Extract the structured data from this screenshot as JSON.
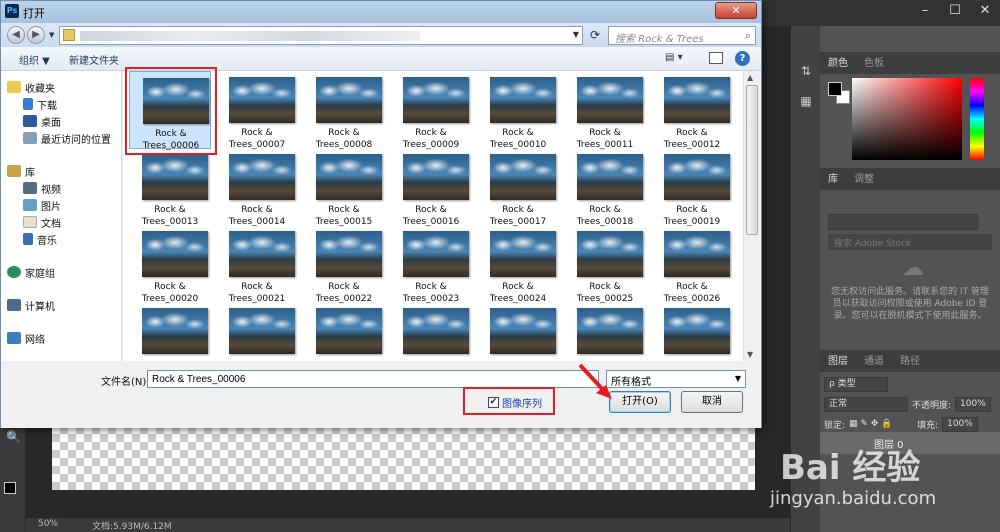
{
  "dialog": {
    "title": "打开",
    "search_placeholder": "搜索 Rock & Trees",
    "toolbar": {
      "organize": "组织 ▼",
      "new_folder": "新建文件夹"
    },
    "nav": {
      "favorites": "收藏夹",
      "downloads": "下载",
      "desktop": "桌面",
      "recent": "最近访问的位置",
      "libraries": "库",
      "videos": "视频",
      "pictures": "图片",
      "documents": "文档",
      "music": "音乐",
      "homegroup": "家庭组",
      "computer": "计算机",
      "network": "网络"
    },
    "files": [
      {
        "l1": "Rock &",
        "l2": "Trees_00006"
      },
      {
        "l1": "Rock &",
        "l2": "Trees_00007"
      },
      {
        "l1": "Rock &",
        "l2": "Trees_00008"
      },
      {
        "l1": "Rock &",
        "l2": "Trees_00009"
      },
      {
        "l1": "Rock &",
        "l2": "Trees_00010"
      },
      {
        "l1": "Rock &",
        "l2": "Trees_00011"
      },
      {
        "l1": "Rock &",
        "l2": "Trees_00012"
      },
      {
        "l1": "Rock &",
        "l2": "Trees_00013"
      },
      {
        "l1": "Rock &",
        "l2": "Trees_00014"
      },
      {
        "l1": "Rock &",
        "l2": "Trees_00015"
      },
      {
        "l1": "Rock &",
        "l2": "Trees_00016"
      },
      {
        "l1": "Rock &",
        "l2": "Trees_00017"
      },
      {
        "l1": "Rock &",
        "l2": "Trees_00018"
      },
      {
        "l1": "Rock &",
        "l2": "Trees_00019"
      },
      {
        "l1": "Rock &",
        "l2": "Trees_00020"
      },
      {
        "l1": "Rock &",
        "l2": "Trees_00021"
      },
      {
        "l1": "Rock &",
        "l2": "Trees_00022"
      },
      {
        "l1": "Rock &",
        "l2": "Trees_00023"
      },
      {
        "l1": "Rock &",
        "l2": "Trees_00024"
      },
      {
        "l1": "Rock &",
        "l2": "Trees_00025"
      },
      {
        "l1": "Rock &",
        "l2": "Trees_00026"
      },
      {
        "l1": "",
        "l2": ""
      },
      {
        "l1": "",
        "l2": ""
      },
      {
        "l1": "",
        "l2": ""
      },
      {
        "l1": "",
        "l2": ""
      },
      {
        "l1": "",
        "l2": ""
      },
      {
        "l1": "",
        "l2": ""
      },
      {
        "l1": "",
        "l2": ""
      }
    ],
    "filename_label": "文件名(N):",
    "filename_value": "Rock & Trees_00006",
    "filter_value": "所有格式",
    "image_sequence_label": "图像序列",
    "image_sequence_checked": true,
    "open_button": "打开(O)",
    "cancel_button": "取消"
  },
  "photoshop": {
    "panels": {
      "color_tab": "颜色",
      "swatches_tab": "色板",
      "library_tab": "库",
      "adjust_tab": "调整",
      "library_search": "搜索 Adobe Stock",
      "library_message": "您无权访问此服务。请联系您的 IT 管理员以获取访问权限或使用 Adobe ID 登录。您可以在脱机模式下使用此服务。",
      "layers_tab": "图层",
      "channels_tab": "通道",
      "paths_tab": "路径",
      "kind_filter": "ρ 类型",
      "blend_mode": "正常",
      "opacity_label": "不透明度:",
      "opacity_value": "100%",
      "lock_label": "锁定:",
      "fill_label": "填充:",
      "fill_value": "100%",
      "layer_name": "图层 0"
    },
    "status": {
      "zoom": "50%",
      "doc": "文档:5.93M/6.12M"
    }
  },
  "colors": {
    "annotation_red": "#e02020",
    "accent_blue": "#2d6fc0"
  }
}
